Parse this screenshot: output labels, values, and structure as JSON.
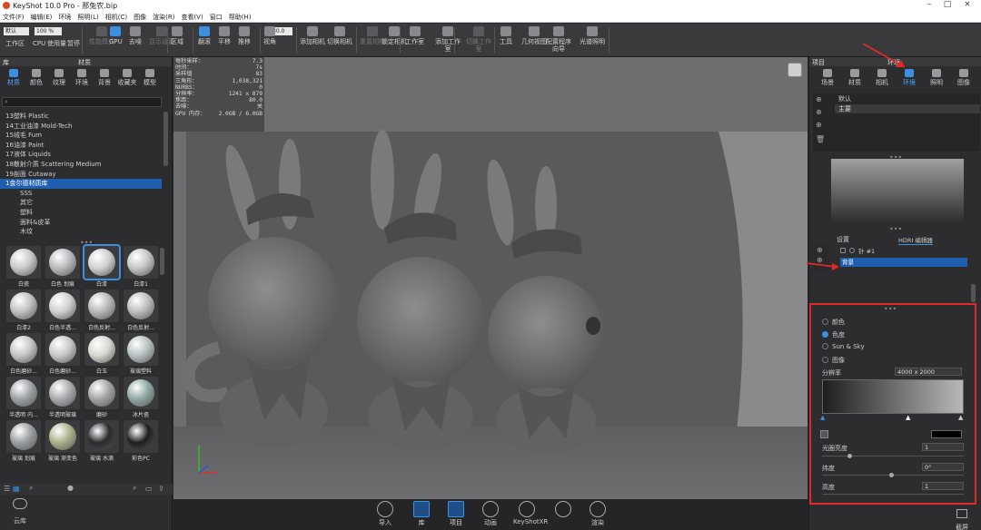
{
  "title_bar": {
    "title": "KeyShot 10.0 Pro - 那兔农.bip",
    "minimize": "–",
    "maximize": "□",
    "close": "×"
  },
  "menu": [
    "文件(F)",
    "编辑(E)",
    "环境",
    "照明(L)",
    "相机(C)",
    "图像",
    "渲染(R)",
    "查看(V)",
    "窗口",
    "帮助(H)"
  ],
  "toolbar": {
    "preset_value": "默认",
    "zoom_value": "100 %",
    "fov_value": "80.0",
    "items": [
      {
        "label": "工作区",
        "state": "normal"
      },
      {
        "label": "CPU",
        "state": "normal"
      },
      {
        "label": "使用量",
        "state": "normal"
      },
      {
        "label": "暂停",
        "state": "normal"
      },
      {
        "label": "性能模式",
        "state": "dim"
      },
      {
        "label": "GPU",
        "state": "blue"
      },
      {
        "label": "去噪",
        "state": "normal"
      },
      {
        "label": "显示设置",
        "state": "dim"
      },
      {
        "label": "区域",
        "state": "normal"
      },
      {
        "label": "翻滚",
        "state": "blue"
      },
      {
        "label": "平移",
        "state": "normal"
      },
      {
        "label": "推移",
        "state": "normal"
      },
      {
        "label": "视角",
        "state": "normal"
      },
      {
        "label": "添加相机",
        "state": "normal"
      },
      {
        "label": "切换相机",
        "state": "normal"
      },
      {
        "label": "重置相机",
        "state": "dim"
      },
      {
        "label": "锁定相机",
        "state": "normal"
      },
      {
        "label": "工作室",
        "state": "normal"
      },
      {
        "label": "添加工作室",
        "state": "normal"
      },
      {
        "label": "切换工作室",
        "state": "dim"
      },
      {
        "label": "工具",
        "state": "normal"
      },
      {
        "label": "几何视图",
        "state": "normal"
      },
      {
        "label": "配置程序向导",
        "state": "normal"
      },
      {
        "label": "光谱照明",
        "state": "normal"
      }
    ]
  },
  "left_panel": {
    "header_left": "库",
    "header_title": "材质",
    "tabs": [
      "材质",
      "颜色",
      "纹理",
      "环境",
      "背景",
      "收藏夹",
      "模型"
    ],
    "search_placeholder": "",
    "tree": [
      {
        "label": "13塑料 Plastic",
        "sel": false,
        "sub": false
      },
      {
        "label": "14工业油漆 Mold-Tech",
        "sel": false,
        "sub": false
      },
      {
        "label": "15绒毛 Fum",
        "sel": false,
        "sub": false
      },
      {
        "label": "16油漆 Paint",
        "sel": false,
        "sub": false
      },
      {
        "label": "17液体 Liquids",
        "sel": false,
        "sub": false
      },
      {
        "label": "18散射介质 Scattering Medium",
        "sel": false,
        "sub": false
      },
      {
        "label": "19剖面 Cutaway",
        "sel": false,
        "sub": false
      },
      {
        "label": "1金尔德材质库",
        "sel": true,
        "sub": false
      },
      {
        "label": "SSS",
        "sel": false,
        "sub": true
      },
      {
        "label": "其它",
        "sel": false,
        "sub": true
      },
      {
        "label": "塑料",
        "sel": false,
        "sub": true
      },
      {
        "label": "面料&皮革",
        "sel": false,
        "sub": true
      },
      {
        "label": "木纹",
        "sel": false,
        "sub": true
      }
    ],
    "thumbs": [
      {
        "label": "白瓷",
        "color": "#c8c8cc"
      },
      {
        "label": "白色 划痕",
        "color": "#b9b9bd"
      },
      {
        "label": "白漆",
        "color": "#d0d0d4"
      },
      {
        "label": "白漆1",
        "color": "#c4c4c8"
      },
      {
        "label": "白漆2",
        "color": "#c0c0c4"
      },
      {
        "label": "白色半透...",
        "color": "#cfcfd3"
      },
      {
        "label": "白色反射...",
        "color": "#b8b8bc"
      },
      {
        "label": "白色反射...",
        "color": "#bdbdc1"
      },
      {
        "label": "白色磨砂...",
        "color": "#c5c5c8"
      },
      {
        "label": "白色磨砂...",
        "color": "#c8c8cb"
      },
      {
        "label": "白玉",
        "color": "#d8d6cf"
      },
      {
        "label": "玻璃塑料",
        "color": "#b8c0c2"
      },
      {
        "label": "半透明 内...",
        "color": "#9ea2a6"
      },
      {
        "label": "半透明玻璃",
        "color": "#a8aaae"
      },
      {
        "label": "磨砂",
        "color": "#a4a4a6"
      },
      {
        "label": "冰片瓷",
        "color": "#8fa7a4"
      },
      {
        "label": "玻璃 划痕",
        "color": "#9a9ea2"
      },
      {
        "label": "玻璃 渐变色",
        "color": "#a9b18a"
      },
      {
        "label": "玻璃 水滴",
        "color": "#2a2a2c"
      },
      {
        "label": "彩色PC",
        "color": "#1f1f21"
      }
    ]
  },
  "viewport": {
    "stats": [
      [
        "每秒采样：",
        "7.3"
      ],
      [
        "时间：",
        "7s"
      ],
      [
        "采样值",
        "83"
      ],
      [
        "三角形：",
        "1,038,321"
      ],
      [
        "NURBS：",
        "0"
      ],
      [
        "分辨率：",
        "1241 x 879"
      ],
      [
        "焦距：",
        "80.0"
      ],
      [
        "去噪：",
        "关"
      ],
      [
        "GPU 内存：",
        "2.0GB / 6.0GB"
      ]
    ]
  },
  "right_panel": {
    "header_left": "项目",
    "header_title": "环境",
    "tabs": [
      "场景",
      "材质",
      "相机",
      "环境",
      "照明",
      "图像"
    ],
    "env_list": [
      "默认",
      "主要"
    ],
    "subtabs": [
      "设置",
      "HDRI 编辑器"
    ],
    "pins": [
      "针 #1",
      "背景"
    ],
    "bg_options": [
      "颜色",
      "色度",
      "Sun & Sky",
      "图像"
    ],
    "bg_selected": 1,
    "resolution_label": "分辨率",
    "resolution_value": "4000 x 2000",
    "brightness_label": "光圈亮度",
    "brightness_value": "1",
    "latitude_label": "纬度",
    "latitude_value": "0°",
    "height_label": "高度",
    "height_value": "1"
  },
  "bottom": {
    "left_label": "云库",
    "right_label": "截屏",
    "buttons": [
      {
        "label": "导入"
      },
      {
        "label": "库"
      },
      {
        "label": "项目"
      },
      {
        "label": "动画"
      },
      {
        "label": "KeyShotXR"
      },
      {
        "label": ""
      },
      {
        "label": "渲染"
      }
    ]
  }
}
